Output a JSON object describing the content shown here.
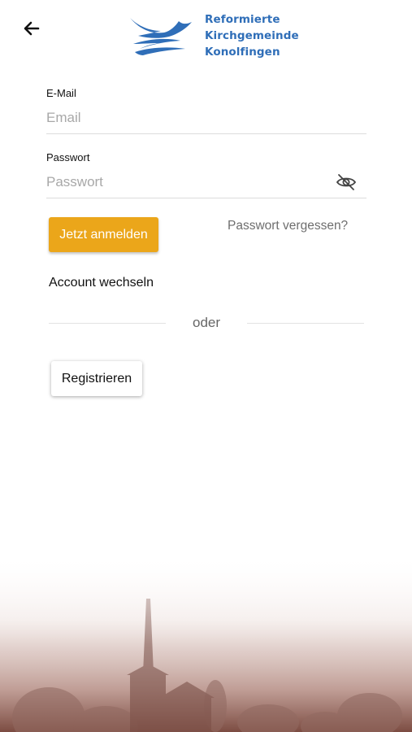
{
  "header": {
    "back_icon": "arrow-left-icon",
    "logo": {
      "line1": "Reformierte",
      "line2": "Kirchgemeinde",
      "line3": "Konolfingen",
      "color": "#2f6eb8"
    }
  },
  "form": {
    "email": {
      "label": "E-Mail",
      "placeholder": "Email",
      "value": ""
    },
    "password": {
      "label": "Passwort",
      "placeholder": "Passwort",
      "value": "",
      "toggle_icon": "eye-off-icon"
    },
    "login_button": "Jetzt anmelden",
    "forgot_link": "Passwort vergessen?",
    "switch_account": "Account wechseln",
    "divider_text": "oder",
    "register_button": "Registrieren"
  },
  "colors": {
    "accent": "#eba61a",
    "background_photo_tint": "#8a5b50"
  },
  "background": {
    "subject": "misty church tower silhouette"
  }
}
